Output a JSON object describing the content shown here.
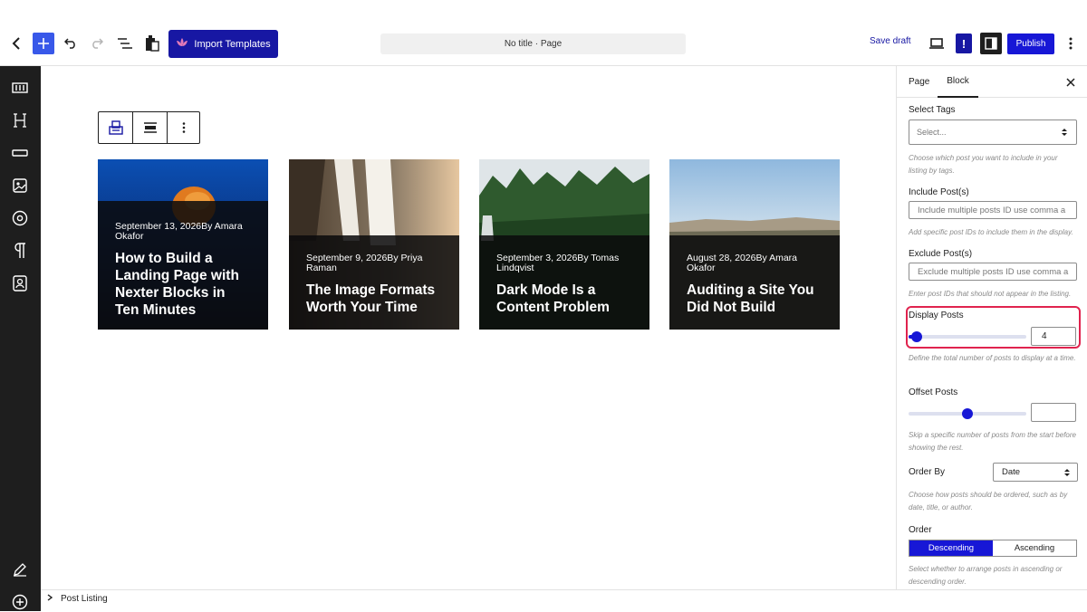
{
  "toolbar": {
    "import_label": "Import Templates",
    "doc_title": "No title · Page",
    "save_draft_label": "Save draft",
    "alert_label": "!",
    "publish_label": "Publish"
  },
  "block_toolbar": {
    "icons": [
      "post-listing-block-icon",
      "align-icon",
      "more-options-icon"
    ]
  },
  "posts": [
    {
      "meta": "September 13, 2026By Amara Okafor",
      "title": "How to Build a Landing Page with Nexter Blocks in Ten Minutes"
    },
    {
      "meta": "September 9, 2026By Priya Raman",
      "title": "The Image Formats Worth Your Time"
    },
    {
      "meta": "September 3, 2026By Tomas Lindqvist",
      "title": "Dark Mode Is a Content Problem"
    },
    {
      "meta": "August 28, 2026By Amara Okafor",
      "title": "Auditing a Site You Did Not Build"
    }
  ],
  "sidebar": {
    "tabs": {
      "page": "Page",
      "block": "Block"
    },
    "select_tags": {
      "label": "Select Tags",
      "placeholder": "Select...",
      "help": "Choose which post you want to include in your listing by tags."
    },
    "include_posts": {
      "label": "Include Post(s)",
      "placeholder": "Include multiple posts ID use comma a",
      "help": "Add specific post IDs to include them in the display."
    },
    "exclude_posts": {
      "label": "Exclude Post(s)",
      "placeholder": "Exclude multiple posts ID use comma a",
      "help": "Enter post IDs that should not appear in the listing."
    },
    "display_posts": {
      "label": "Display Posts",
      "value": "4",
      "slider_fraction": 0.07,
      "help": "Define the total number of posts to display at a time."
    },
    "offset_posts": {
      "label": "Offset Posts",
      "value": "",
      "slider_fraction": 0.5,
      "help": "Skip a specific number of posts from the start before showing the rest."
    },
    "order_by": {
      "label": "Order By",
      "value": "Date",
      "help": "Choose how posts should be ordered, such as by date, title, or author."
    },
    "order": {
      "label": "Order",
      "options": [
        "Descending",
        "Ascending"
      ],
      "selected": "Descending",
      "help": "Select whether to arrange posts in ascending or descending order."
    }
  },
  "footer": {
    "breadcrumb": "Post Listing"
  },
  "colors": {
    "accent": "#1717d6",
    "import_button": "#1717a3",
    "highlight": "#e0234e"
  }
}
